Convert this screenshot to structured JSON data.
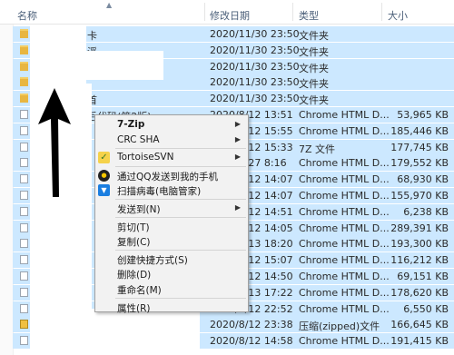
{
  "columns": {
    "name": "名称",
    "modified": "修改日期",
    "type": "类型",
    "size": "大小"
  },
  "rows": [
    {
      "icon": "folder",
      "name": "卡",
      "date": "2020/11/30 23:50",
      "type": "文件夹",
      "size": ""
    },
    {
      "icon": "folder",
      "name": "浮",
      "date": "2020/11/30 23:50",
      "type": "文件夹",
      "size": ""
    },
    {
      "icon": "folder",
      "name": "!",
      "date": "2020/11/30 23:50",
      "type": "文件夹",
      "size": ""
    },
    {
      "icon": "folder",
      "name": "",
      "date": "2020/11/30 23:50",
      "type": "文件夹",
      "size": ""
    },
    {
      "icon": "folder",
      "name": "首",
      "date": "2020/11/30 23:50",
      "type": "文件夹",
      "size": ""
    },
    {
      "icon": "file",
      "name": "后代码(第2版)",
      "date": "2020/8/12 13:51",
      "type": "Chrome HTML D...",
      "size": "53,965 KB"
    },
    {
      "icon": "file",
      "name": "",
      "date": "2020/8/12 15:55",
      "type": "Chrome HTML D...",
      "size": "185,446 KB"
    },
    {
      "icon": "file",
      "name": "",
      "date": "2020/8/12 15:33",
      "type": "7Z 文件",
      "size": "177,745 KB"
    },
    {
      "icon": "file",
      "name": "",
      "date": "2020/7/27 8:16",
      "type": "Chrome HTML D...",
      "size": "179,552 KB"
    },
    {
      "icon": "file",
      "name": "",
      "date": "2020/8/12 14:07",
      "type": "Chrome HTML D...",
      "size": "68,930 KB"
    },
    {
      "icon": "file",
      "name": "",
      "date": "2020/8/12 14:07",
      "type": "Chrome HTML D...",
      "size": "155,970 KB"
    },
    {
      "icon": "file",
      "name": "",
      "date": "2020/8/12 14:51",
      "type": "Chrome HTML D...",
      "size": "6,238 KB"
    },
    {
      "icon": "file",
      "name": "",
      "date": "2020/8/12 14:05",
      "type": "Chrome HTML D...",
      "size": "289,391 KB"
    },
    {
      "icon": "file",
      "name": "",
      "date": "2020/7/13 18:20",
      "type": "Chrome HTML D...",
      "size": "193,300 KB"
    },
    {
      "icon": "file",
      "name": "",
      "date": "2020/8/12 15:07",
      "type": "Chrome HTML D...",
      "size": "116,212 KB"
    },
    {
      "icon": "file",
      "name": "",
      "date": "2020/8/12 14:50",
      "type": "Chrome HTML D...",
      "size": "69,151 KB"
    },
    {
      "icon": "file",
      "name": "",
      "date": "2020/8/13 17:22",
      "type": "Chrome HTML D...",
      "size": "178,620 KB"
    },
    {
      "icon": "file",
      "name": "",
      "date": "2020/8/12 22:52",
      "type": "Chrome HTML D...",
      "size": "6,550 KB"
    },
    {
      "icon": "zip",
      "name": "",
      "date": "2020/8/12 23:38",
      "type": "压缩(zipped)文件",
      "size": "166,645 KB"
    },
    {
      "icon": "file",
      "name": "",
      "date": "2020/8/12 14:58",
      "type": "Chrome HTML D...",
      "size": "191,415 KB"
    }
  ],
  "menu": [
    {
      "label": "7-Zip",
      "submenu": true,
      "bold": true,
      "icon": ""
    },
    {
      "label": "CRC SHA",
      "submenu": true,
      "icon": ""
    },
    {
      "sep": true
    },
    {
      "label": "TortoiseSVN",
      "submenu": true,
      "icon": "tortoise-icon"
    },
    {
      "sep": true
    },
    {
      "label": "通过QQ发送到我的手机",
      "icon": "qq-icon"
    },
    {
      "label": "扫描病毒(电脑管家)",
      "icon": "shield-icon"
    },
    {
      "sep": true
    },
    {
      "label": "发送到(N)",
      "submenu": true,
      "icon": ""
    },
    {
      "sep": true
    },
    {
      "label": "剪切(T)",
      "icon": ""
    },
    {
      "label": "复制(C)",
      "icon": ""
    },
    {
      "sep": true
    },
    {
      "label": "创建快捷方式(S)",
      "icon": ""
    },
    {
      "label": "删除(D)",
      "icon": ""
    },
    {
      "label": "重命名(M)",
      "icon": ""
    },
    {
      "sep": true
    },
    {
      "label": "属性(R)",
      "icon": ""
    }
  ],
  "colors": {
    "selection": "#cce8ff",
    "menu_bg": "#f2f2f2",
    "header_text": "#4c607a",
    "arrow": "#000000"
  }
}
